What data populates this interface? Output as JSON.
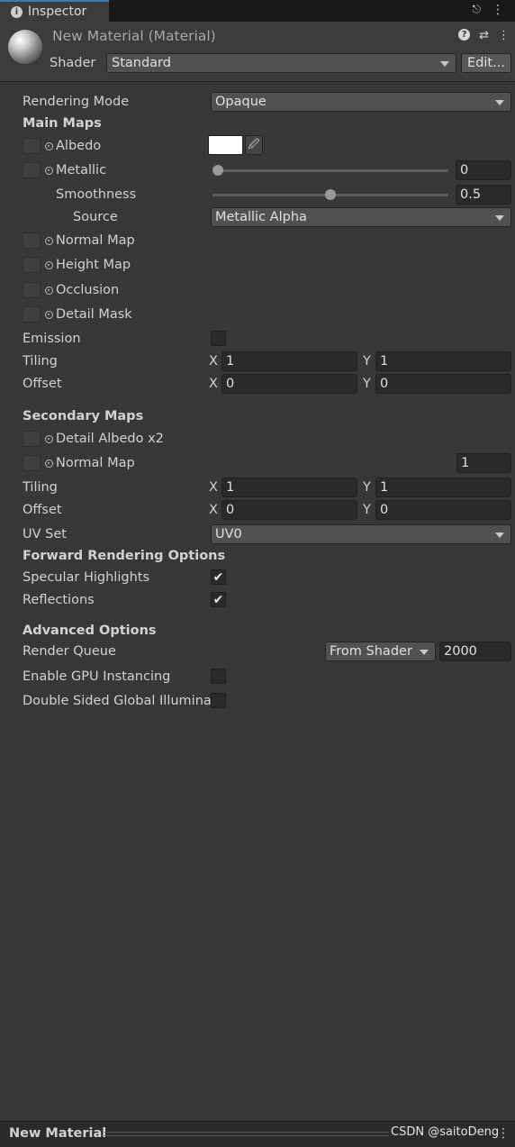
{
  "tab": {
    "title": "Inspector",
    "icon": "info-icon",
    "lock_icon": "lock-icon",
    "menu_icon": "kebab-menu-icon"
  },
  "header": {
    "title": "New Material (Material)",
    "shader_label": "Shader",
    "shader_value": "Standard",
    "edit_label": "Edit...",
    "icons": [
      "help-icon",
      "preset-icon",
      "kebab-menu-icon"
    ]
  },
  "rendering_mode": {
    "label": "Rendering Mode",
    "value": "Opaque"
  },
  "main_maps": {
    "heading": "Main Maps",
    "albedo": {
      "label": "Albedo",
      "color": "#ffffff"
    },
    "metallic": {
      "label": "Metallic",
      "value": "0",
      "fraction": 0.0
    },
    "smoothness": {
      "label": "Smoothness",
      "value": "0.5",
      "fraction": 0.5
    },
    "source": {
      "label": "Source",
      "value": "Metallic Alpha"
    },
    "normal_map": {
      "label": "Normal Map"
    },
    "height_map": {
      "label": "Height Map"
    },
    "occlusion": {
      "label": "Occlusion"
    },
    "detail_mask": {
      "label": "Detail Mask"
    },
    "emission": {
      "label": "Emission",
      "checked": false
    },
    "tiling": {
      "label": "Tiling",
      "x_label": "X",
      "x": "1",
      "y_label": "Y",
      "y": "1"
    },
    "offset": {
      "label": "Offset",
      "x_label": "X",
      "x": "0",
      "y_label": "Y",
      "y": "0"
    }
  },
  "secondary_maps": {
    "heading": "Secondary Maps",
    "detail_albedo": {
      "label": "Detail Albedo x2"
    },
    "normal_map": {
      "label": "Normal Map",
      "value": "1"
    },
    "tiling": {
      "label": "Tiling",
      "x_label": "X",
      "x": "1",
      "y_label": "Y",
      "y": "1"
    },
    "offset": {
      "label": "Offset",
      "x_label": "X",
      "x": "0",
      "y_label": "Y",
      "y": "0"
    },
    "uv_set": {
      "label": "UV Set",
      "value": "UV0"
    }
  },
  "forward_rendering": {
    "heading": "Forward Rendering Options",
    "specular": {
      "label": "Specular Highlights",
      "checked": true
    },
    "reflections": {
      "label": "Reflections",
      "checked": true
    }
  },
  "advanced": {
    "heading": "Advanced Options",
    "render_queue": {
      "label": "Render Queue",
      "mode": "From Shader",
      "value": "2000"
    },
    "gpu_instancing": {
      "label": "Enable GPU Instancing",
      "checked": false
    },
    "double_sided_gi": {
      "label": "Double Sided Global Illumina",
      "checked": false
    }
  },
  "footer": {
    "title": "New Material",
    "watermark": "CSDN @saitoDeng",
    "menu_icon": "kebab-menu-icon"
  },
  "glyphs": {
    "check": "✔",
    "lock": "🔓",
    "kebab": "⋮",
    "eyedropper": "🖉",
    "preset": "⇄"
  }
}
